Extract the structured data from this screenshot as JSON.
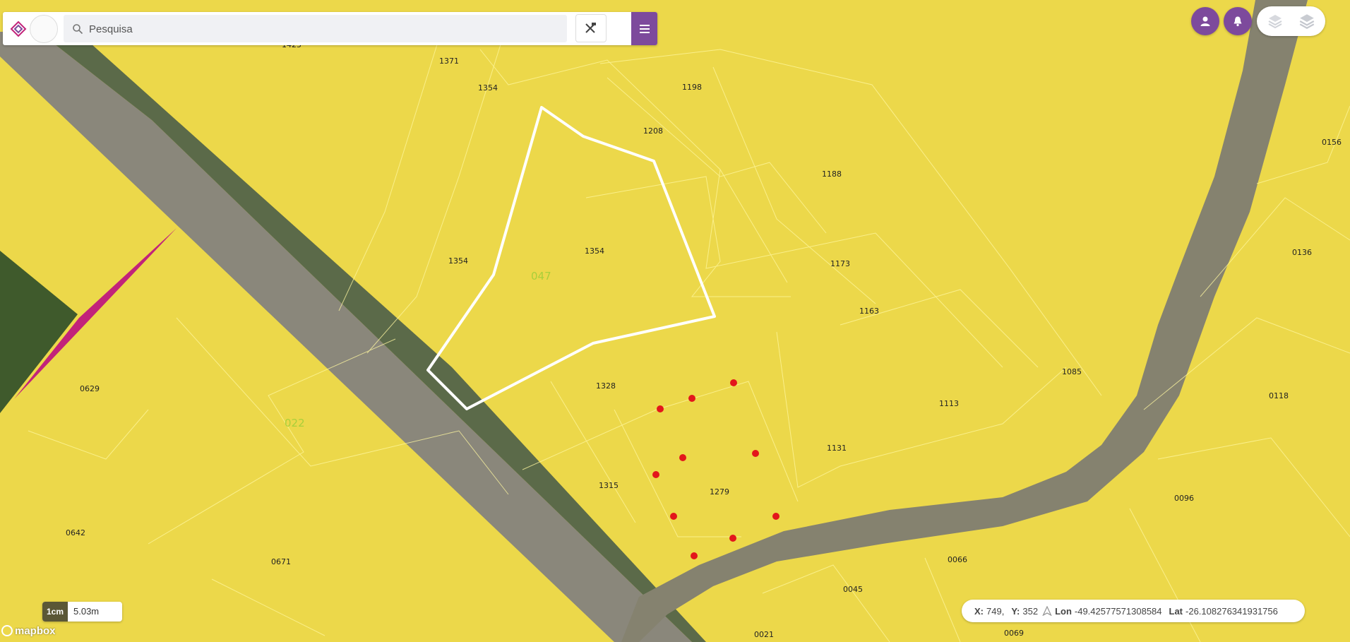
{
  "search": {
    "placeholder": "Pesquisa"
  },
  "map": {
    "colors": {
      "parcel_fill": "#ecd84a",
      "road": "#8a877b",
      "selection": "#ffffff",
      "markers": "#e3161b",
      "accent_strip": "#c2237a",
      "brand": "#7d4a9c"
    },
    "block_labels": [
      "047",
      "022"
    ],
    "parcel_labels": [
      "1425",
      "1371",
      "1354",
      "1198",
      "1208",
      "1188",
      "1354",
      "1354",
      "1173",
      "1163",
      "0156",
      "0136",
      "1085",
      "0118",
      "1328",
      "1113",
      "0629",
      "1131",
      "1315",
      "1279",
      "0096",
      "0642",
      "0671",
      "0066",
      "0045",
      "0021",
      "0069"
    ]
  },
  "scale": {
    "unit": "1cm",
    "value": "5.03m"
  },
  "attribution": {
    "logo": "mapbox"
  },
  "coords": {
    "x_label": "X:",
    "x_value": "749,",
    "y_label": "Y:",
    "y_value": "352",
    "lon_label": "Lon",
    "lon_value": "-49.42577571308584",
    "lat_label": "Lat",
    "lat_value": "-26.108276341931756"
  },
  "icons": {
    "search": "search-icon",
    "tools": "tools-icon",
    "menu": "menu-icon",
    "user": "user-icon",
    "bell": "bell-icon",
    "layers": "layers-icon",
    "north": "north-arrow-icon"
  }
}
